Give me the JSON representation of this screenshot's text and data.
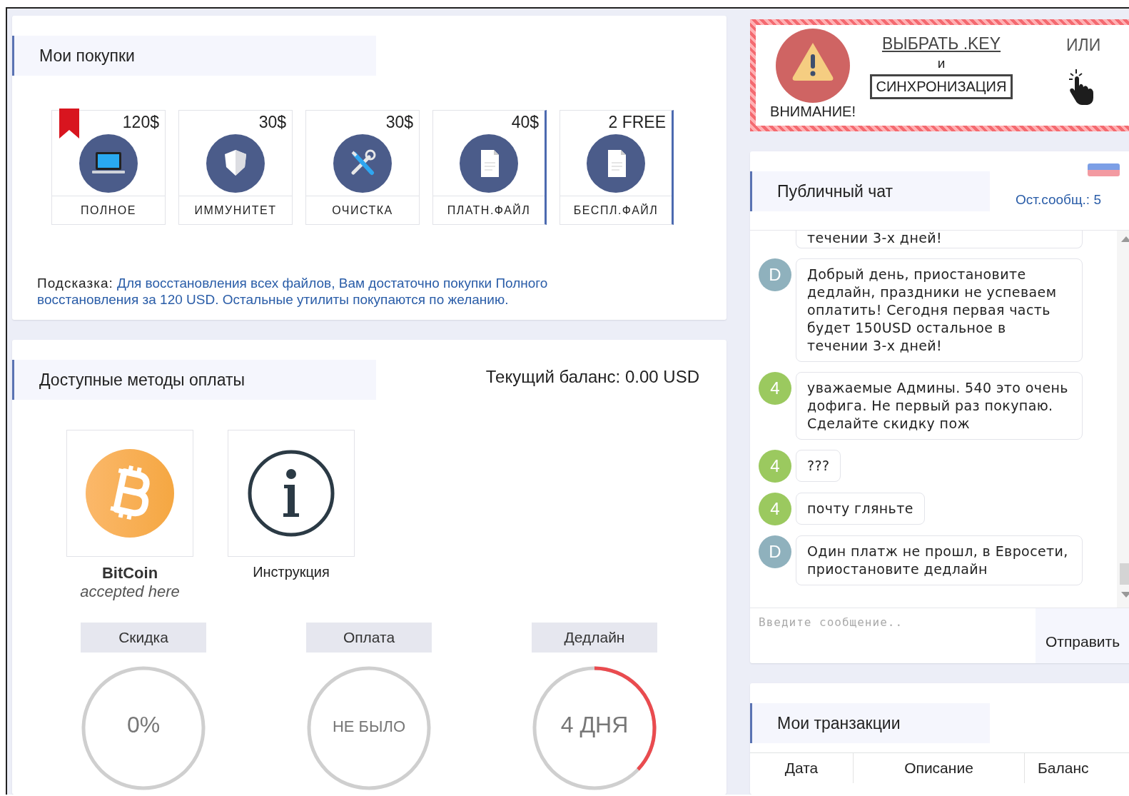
{
  "purchases": {
    "title": "Мои покупки",
    "products": [
      {
        "price": "120$",
        "label": "ПОЛНОЕ",
        "kind": "laptop",
        "bookmarked": true,
        "highlighted": false
      },
      {
        "price": "30$",
        "label": "ИММУНИТЕТ",
        "kind": "shield",
        "bookmarked": false,
        "highlighted": false
      },
      {
        "price": "30$",
        "label": "ОЧИСТКА",
        "kind": "tools",
        "bookmarked": false,
        "highlighted": false
      },
      {
        "price": "40$",
        "label": "ПЛАТН.ФАЙЛ",
        "kind": "file",
        "bookmarked": false,
        "highlighted": true
      },
      {
        "price": "2 FREE",
        "label": "БЕСПЛ.ФАЙЛ",
        "kind": "file",
        "bookmarked": false,
        "highlighted": true
      }
    ],
    "hint": {
      "label": "Подсказка:",
      "text": "Для восстановления всех файлов, Вам достаточно покупки Полного восстановления за 120 USD. Остальные утилиты покупаются по желанию."
    }
  },
  "payment": {
    "title": "Доступные методы оплаты",
    "balance": "Текущий баланс: 0.00 USD",
    "methods": [
      {
        "kind": "bitcoin",
        "name": "BitCoin",
        "note": "accepted here"
      },
      {
        "kind": "info",
        "name": "Инструкция"
      }
    ],
    "stats": [
      {
        "label": "Скидка",
        "value": "0%",
        "kind": "plain"
      },
      {
        "label": "Оплата",
        "value": "НЕ БЫЛО",
        "kind": "plain"
      },
      {
        "label": "Дедлайн",
        "value": "4 ДНЯ",
        "kind": "countdown"
      }
    ]
  },
  "alert": {
    "caption": "ВНИМАНИЕ!",
    "link": "ВЫБРАТЬ .KEY",
    "conjunction": "и",
    "button": "СИНХРОНИЗАЦИЯ",
    "or": "ИЛИ"
  },
  "chat": {
    "title": "Публичный чат",
    "remaining": "Ост.сообщ.: 5",
    "messages": [
      {
        "kind": "partial",
        "text": "течении 3-х дней!"
      },
      {
        "kind": "full",
        "author": "D",
        "color": "#8fb1bd",
        "text": "Добрый день, приостановите дедлайн, праздники не успеваем оплатить! Сегодня первая часть будет 150USD остальное в течении 3-х дней!"
      },
      {
        "kind": "full",
        "author": "4",
        "color": "#9bc95f",
        "text": "уважаемые Админы. 540 это очень дофига. Не первый раз покупаю. Сделайте скидку пож"
      },
      {
        "kind": "full",
        "author": "4",
        "color": "#9bc95f",
        "text": "???"
      },
      {
        "kind": "full",
        "author": "4",
        "color": "#9bc95f",
        "text": "почту гляньте"
      },
      {
        "kind": "full",
        "author": "D",
        "color": "#8fb1bd",
        "text": "Один платж не прошл, в Евросети, приостановите дедлайн"
      }
    ],
    "input": {
      "placeholder": "Введите сообщение.."
    },
    "send": "Отправить"
  },
  "transactions": {
    "title": "Мои транзакции",
    "columns": [
      "Дата",
      "Описание",
      "Баланс"
    ]
  }
}
